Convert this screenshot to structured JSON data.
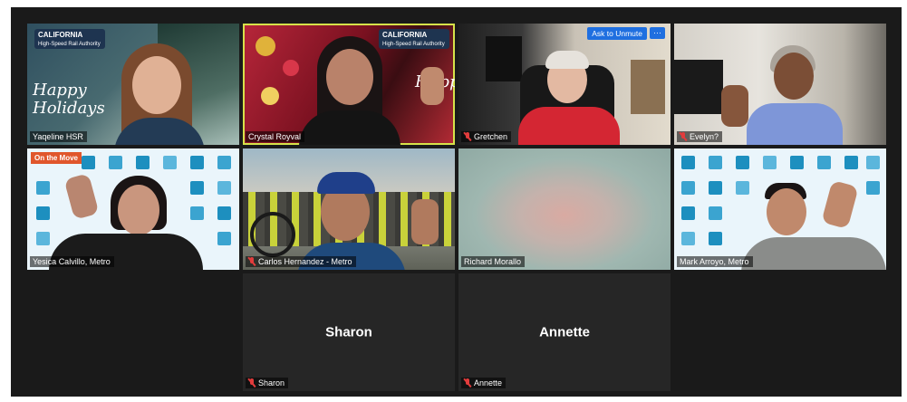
{
  "gallery": {
    "tiles": [
      {
        "name": "Yaqeline HSR",
        "muted": false,
        "banner_top": "CALIFORNIA",
        "banner_sub": "High-Speed Rail Authority",
        "background_text": "Happy Holidays"
      },
      {
        "name": "Crystal Royval",
        "muted": false,
        "active_speaker": true,
        "banner_top": "CALIFORNIA",
        "banner_sub": "High-Speed Rail Authority",
        "background_text": "Happy"
      },
      {
        "name": "Gretchen",
        "muted": true
      },
      {
        "name": "Evelyn?",
        "muted": true
      },
      {
        "name": "Yesica Calvillo, Metro",
        "muted": false,
        "badge": "On the Move"
      },
      {
        "name": "Carlos Hernandez - Metro",
        "muted": true
      },
      {
        "name": "Richard Morallo",
        "muted": false
      },
      {
        "name": "Mark Arroyo, Metro",
        "muted": false
      },
      {
        "name": "Sharon",
        "muted": true,
        "camera_off_label": "Sharon"
      },
      {
        "name": "Annette",
        "muted": true,
        "camera_off_label": "Annette"
      }
    ]
  },
  "hover_controls": {
    "ask_to_unmute": "Ask to Unmute",
    "more": "···"
  },
  "colors": {
    "active_speaker_border": "#d6e24a",
    "muted_icon": "#e23c3c",
    "button_blue": "#1f6fe0",
    "gallery_bg": "#1a1a1a"
  }
}
